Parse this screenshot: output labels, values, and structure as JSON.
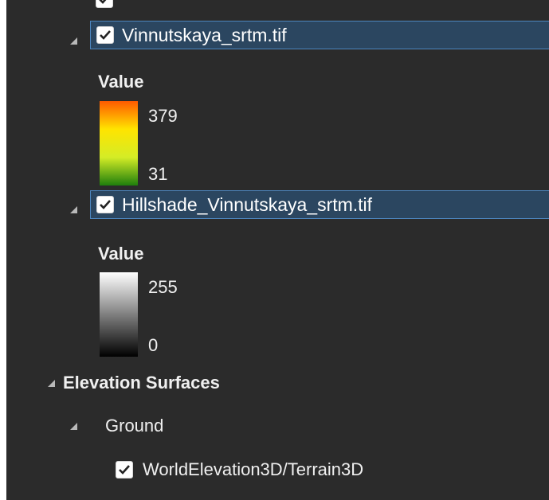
{
  "layers": [
    {
      "name": "Vinnutskaya_srtm.tif",
      "checked": true,
      "legend": {
        "heading": "Value",
        "max": "379",
        "min": "31",
        "ramp": [
          "#ff5a00",
          "#ffe400",
          "#d4ec26",
          "#1e7e0c"
        ]
      }
    },
    {
      "name": "Hillshade_Vinnutskaya_srtm.tif",
      "checked": true,
      "legend": {
        "heading": "Value",
        "max": "255",
        "min": "0",
        "ramp": [
          "#ffffff",
          "#000000"
        ]
      }
    }
  ],
  "elevation_surfaces": {
    "label": "Elevation Surfaces",
    "ground": {
      "label": "Ground",
      "source": {
        "name": "WorldElevation3D/Terrain3D",
        "checked": true
      }
    }
  },
  "colors": {
    "panel_bg": "#2b2b2b",
    "selection_bg": "#2b4660",
    "selection_border": "#4d86bf"
  }
}
